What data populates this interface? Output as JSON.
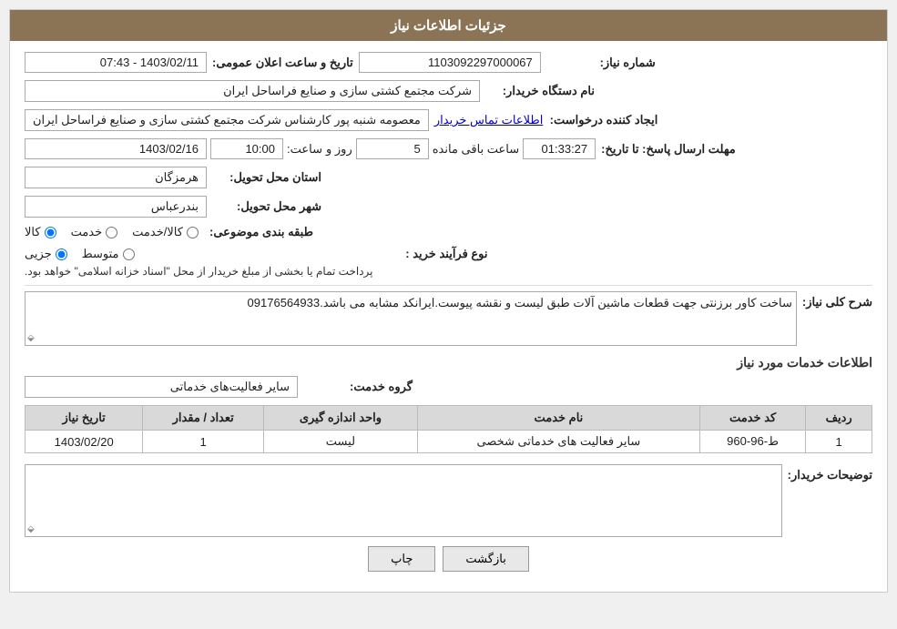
{
  "header": {
    "title": "جزئیات اطلاعات نیاز"
  },
  "fields": {
    "need_number_label": "شماره نیاز:",
    "need_number_value": "1103092297000067",
    "announce_date_label": "تاریخ و ساعت اعلان عمومی:",
    "announce_date_value": "1403/02/11 - 07:43",
    "buyer_name_label": "نام دستگاه خریدار:",
    "buyer_name_value": "شرکت مجتمع کشتی سازی و صنایع فراساحل ایران",
    "creator_label": "ایجاد کننده درخواست:",
    "creator_value": "معصومه شنبه پور کارشناس شرکت مجتمع کشتی سازی و صنایع فراساحل ایران",
    "contact_link": "اطلاعات تماس خریدار",
    "send_deadline_label": "مهلت ارسال پاسخ: تا تاریخ:",
    "send_deadline_date": "1403/02/16",
    "send_deadline_time_label": "ساعت:",
    "send_deadline_time": "10:00",
    "send_deadline_days_label": "روز و",
    "send_deadline_days": "5",
    "send_deadline_remaining_label": "ساعت باقی مانده",
    "send_deadline_remaining": "01:33:27",
    "province_label": "استان محل تحویل:",
    "province_value": "هرمزگان",
    "city_label": "شهر محل تحویل:",
    "city_value": "بندرعباس",
    "category_label": "طبقه بندی موضوعی:",
    "category_options": [
      "کالا",
      "خدمت",
      "کالا/خدمت"
    ],
    "category_selected": "کالا",
    "purchase_type_label": "نوع فرآیند خرید :",
    "purchase_type_options": [
      "جزیی",
      "متوسط"
    ],
    "purchase_type_note": "پرداخت تمام یا بخشی از مبلغ خریدار از محل \"اسناد خزانه اسلامی\" خواهد بود.",
    "description_label": "شرح کلی نیاز:",
    "description_value": "ساخت کاور برزنتی جهت قطعات ماشین آلات طبق لیست و نقشه پیوست.ایرانکد مشابه می باشد.09176564933",
    "services_section_label": "اطلاعات خدمات مورد نیاز",
    "service_group_label": "گروه خدمت:",
    "service_group_value": "سایر فعالیت‌های خدماتی",
    "table_headers": [
      "ردیف",
      "کد خدمت",
      "نام خدمت",
      "واحد اندازه گیری",
      "تعداد / مقدار",
      "تاریخ نیاز"
    ],
    "table_rows": [
      {
        "row": "1",
        "code": "ط-96-960",
        "name": "سایر فعالیت های خدماتی شخصی",
        "unit": "لیست",
        "quantity": "1",
        "date": "1403/02/20"
      }
    ],
    "buyer_notes_label": "توضیحات خریدار:"
  },
  "buttons": {
    "print": "چاپ",
    "back": "بازگشت"
  }
}
